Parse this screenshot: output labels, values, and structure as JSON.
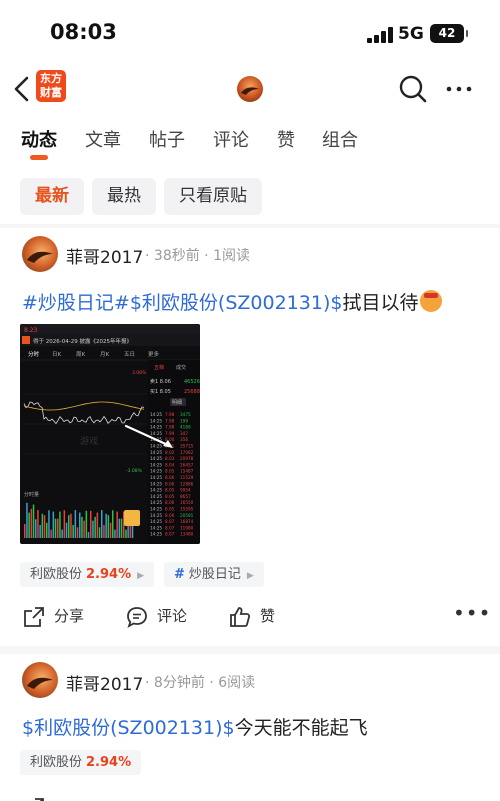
{
  "status_bar": {
    "time": "08:03",
    "network": "5G",
    "battery": "42"
  },
  "nav": {
    "logo_line1": "东方",
    "logo_line2": "财富"
  },
  "tabs": [
    {
      "label": "动态"
    },
    {
      "label": "文章"
    },
    {
      "label": "帖子"
    },
    {
      "label": "评论"
    },
    {
      "label": "赞"
    },
    {
      "label": "组合"
    }
  ],
  "filters": [
    {
      "label": "最新"
    },
    {
      "label": "最热"
    },
    {
      "label": "只看原贴"
    }
  ],
  "posts": [
    {
      "user": "菲哥2017",
      "time": "38秒前",
      "reads": "1阅读",
      "tag1": "#炒股日记#",
      "tag2": "$利欧股份(SZ002131)$",
      "text": "拭目以待",
      "stock_pill": {
        "name": "利欧股份",
        "change": "2.94%"
      },
      "topic_pill": {
        "hash": "#",
        "name": "炒股日记"
      }
    },
    {
      "user": "菲哥2017",
      "time": "8分钟前",
      "reads": "6阅读",
      "tag1": "$利欧股份(SZ002131)$",
      "text": "今天能不能起飞",
      "stock_pill": {
        "name": "利欧股份",
        "change": "2.94%"
      }
    }
  ],
  "actions": {
    "share": "分享",
    "comment": "评论",
    "like": "赞"
  },
  "screenshot": {
    "title_line": "得于 2026-04-29 披露《2025年年报》",
    "tabs": [
      "分时",
      "日K",
      "周K",
      "月K",
      "五日",
      "更多"
    ],
    "price": "8.23",
    "ask_label": "卖1",
    "ask_price": "8.06",
    "bid_label": "买1",
    "bid_price": "8.05",
    "detail_label": "明细",
    "side_tabs": [
      "五档",
      "成交"
    ],
    "pct_up": "3.08%",
    "pct_down": "-3.08%",
    "vol_top": "46526",
    "vol_bid": "25688",
    "ticks": [
      "14:25",
      "14:25",
      "14:25",
      "14:25",
      "14:25",
      "14:25",
      "14:25",
      "14:25",
      "14:25",
      "14:25",
      "14:25",
      "14:25",
      "14:25",
      "14:25",
      "14:25",
      "14:25",
      "14:25",
      "14:25",
      "14:25",
      "14:25"
    ],
    "tick_prices": [
      "7.98",
      "7.98",
      "7.98",
      "7.99",
      "8.00",
      "8.01",
      "8.02",
      "8.03",
      "8.04",
      "8.05",
      "8.06",
      "8.06",
      "8.05",
      "8.05",
      "8.06",
      "8.05",
      "8.06",
      "8.07",
      "8.07",
      "8.07"
    ],
    "tick_vols": [
      "3475",
      "199",
      "4169",
      "347",
      "356",
      "35715",
      "17082",
      "20978",
      "26457",
      "15487",
      "11529",
      "12886",
      "9954",
      "8657",
      "16550",
      "15595",
      "20591",
      "16874",
      "11980",
      "13480"
    ],
    "tick_colors": [
      "#2fbf4a",
      "#2fbf4a",
      "#2fbf4a",
      "#e84040",
      "#e84040",
      "#e84040",
      "#e84040",
      "#e84040",
      "#e84040",
      "#e84040",
      "#e84040",
      "#e84040",
      "#e84040",
      "#e84040",
      "#e84040",
      "#e84040",
      "#2fbf4a",
      "#e84040",
      "#e84040",
      "#e84040"
    ],
    "subchart_label": "分时量",
    "watermark": "游戏"
  }
}
